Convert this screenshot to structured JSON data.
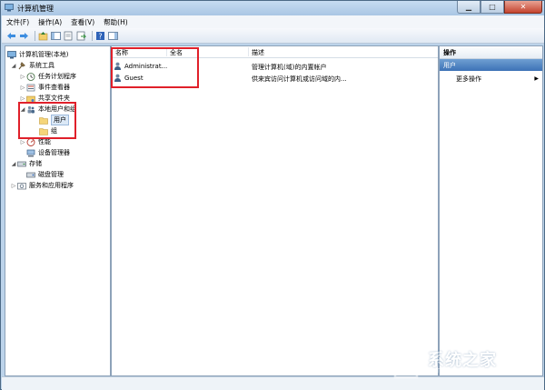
{
  "window": {
    "title": "计算机管理"
  },
  "menu": [
    "文件(F)",
    "操作(A)",
    "查看(V)",
    "帮助(H)"
  ],
  "tree": {
    "root": "计算机管理(本地)",
    "system_tools": "系统工具",
    "task_scheduler": "任务计划程序",
    "event_viewer": "事件查看器",
    "shared_folders": "共享文件夹",
    "local_users_groups": "本地用户和组",
    "users": "用户",
    "groups": "组",
    "performance": "性能",
    "device_manager": "设备管理器",
    "storage": "存储",
    "disk_management": "磁盘管理",
    "services_apps": "服务和应用程序"
  },
  "list": {
    "columns": {
      "name": "名称",
      "fullname": "全名",
      "description": "描述"
    },
    "rows": [
      {
        "name": "Administrat...",
        "fullname": "",
        "description": "管理计算机(域)的内置帐户"
      },
      {
        "name": "Guest",
        "fullname": "",
        "description": "供来宾访问计算机或访问域的内..."
      }
    ]
  },
  "actions": {
    "header": "操作",
    "section": "用户",
    "more": "更多操作"
  },
  "watermark": {
    "text": "系统之家",
    "sub": "XITONGZHIJIA.NET"
  },
  "colors": {
    "red_highlight": "#e0202a",
    "selection": "#3d72b6",
    "titlebar": "#a9c6e4"
  }
}
